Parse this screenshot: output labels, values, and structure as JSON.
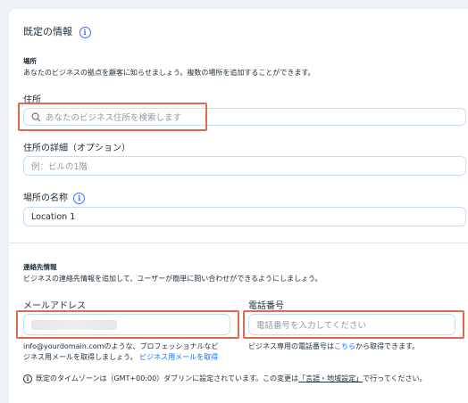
{
  "defaults": {
    "title": "既定の情報"
  },
  "location": {
    "heading": "場所",
    "description": "あなたのビジネスの拠点を顧客に知らせましょう。複数の場所を追加することができます。",
    "address_label": "住所",
    "address_placeholder": "あなたのビジネス住所を検索します",
    "details_label": "住所の詳細（オプション）",
    "details_placeholder": "例：ビルの1階",
    "name_label": "場所の名称",
    "name_value": "Location 1"
  },
  "contact": {
    "heading": "連絡先情報",
    "description": "ビジネスの連絡先情報を追加して、ユーザーが簡単に問い合わせができるようにしましょう。",
    "email_label": "メールアドレス",
    "email_help_line1": "info@yourdomain.comのような、プロフェッショナルなビ",
    "email_help_line2": "ジネス用メールを取得しましょう。",
    "email_help_link": "ビジネス用メールを取得",
    "phone_label": "電話番号",
    "phone_placeholder": "電話番号を入力してください",
    "phone_help_prefix": "ビジネス専用の電話番号は",
    "phone_help_link": "こちら",
    "phone_help_suffix": "から取得できます。"
  },
  "timezone": {
    "prefix": "既定のタイムゾーンは（GMT+00:00）ダブリンに設定されています。この変更は",
    "link": "「言語・地域設定」",
    "suffix": "で行ってください。"
  },
  "colors": {
    "accent": "#116dff",
    "highlight": "#e06a4f",
    "input_border": "#c6dcfb"
  }
}
